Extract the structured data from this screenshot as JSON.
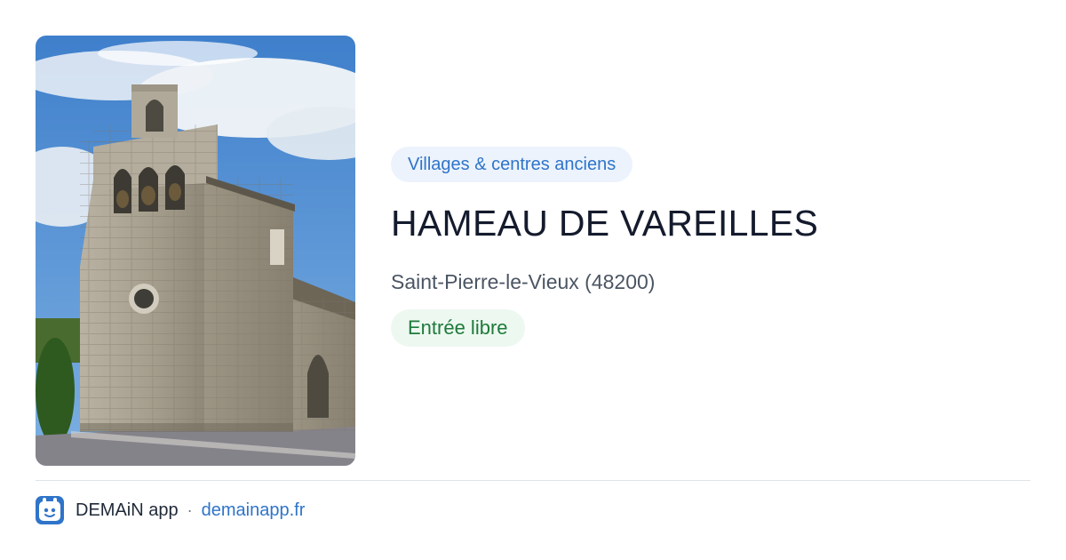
{
  "place": {
    "category": "Villages & centres anciens",
    "name": "HAMEAU DE VAREILLES",
    "address": "Saint-Pierre-le-Vieux (48200)",
    "access": "Entrée libre"
  },
  "photo": {
    "subject": "stone church bell tower"
  },
  "footer": {
    "app_name": "DEMAiN app",
    "separator": "·",
    "domain": "demainapp.fr"
  },
  "colors": {
    "accent": "#2f74c9",
    "tag_bg": "#ecf3fc",
    "success": "#1f7a3b",
    "success_bg": "#edf8f0",
    "title": "#141b2d"
  }
}
